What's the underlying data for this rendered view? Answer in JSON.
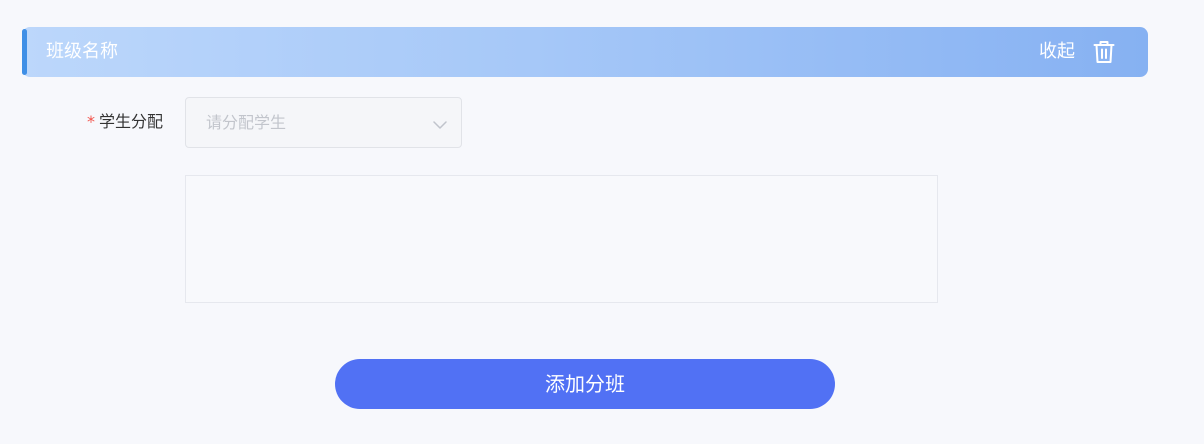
{
  "class_section": {
    "title": "班级名称",
    "collapse_label": "收起",
    "delete_icon": "trash-icon"
  },
  "form": {
    "student_assign": {
      "required_mark": "*",
      "label": "学生分配",
      "placeholder": "请分配学生",
      "dropdown_icon": "chevron-down-icon"
    }
  },
  "actions": {
    "add_class_label": "添加分班"
  },
  "colors": {
    "accent": "#3f8fe6",
    "primary_button": "#5171f4",
    "required": "#f2534b",
    "header_gradient_start": "#bcd7fb",
    "header_gradient_end": "#86b1f2"
  }
}
